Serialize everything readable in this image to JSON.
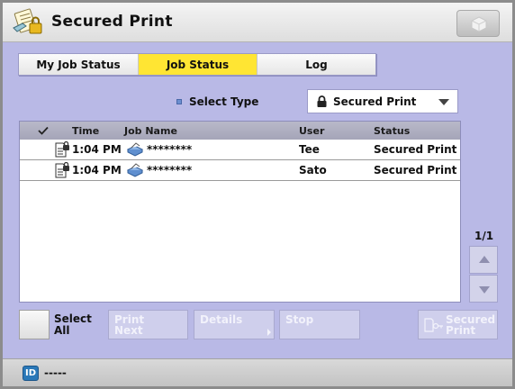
{
  "header": {
    "title": "Secured Print"
  },
  "tabs": [
    {
      "label": "My Job Status",
      "active": false
    },
    {
      "label": "Job Status",
      "active": true
    },
    {
      "label": "Log",
      "active": false
    }
  ],
  "filter": {
    "label": "Select Type",
    "selected": "Secured Print"
  },
  "table": {
    "columns": [
      "Time",
      "Job Name",
      "User",
      "Status"
    ],
    "rows": [
      {
        "time": "1:04 PM",
        "job_name": "********",
        "user": "Tee",
        "status": "Secured Print"
      },
      {
        "time": "1:04 PM",
        "job_name": "********",
        "user": "Sato",
        "status": "Secured Print"
      }
    ]
  },
  "pagination": {
    "page": "1/1"
  },
  "actions": {
    "select_all_line1": "Select",
    "select_all_line2": "All",
    "print_next_line1": "Print",
    "print_next_line2": "Next",
    "details": "Details",
    "stop": "Stop",
    "secured_print_line1": "Secured",
    "secured_print_line2": "Print"
  },
  "status_bar": {
    "id_badge": "ID",
    "user_text": "-----"
  },
  "colors": {
    "background": "#b9b9e6",
    "active_tab": "#ffe533",
    "disabled_button": "#cfcfec"
  }
}
